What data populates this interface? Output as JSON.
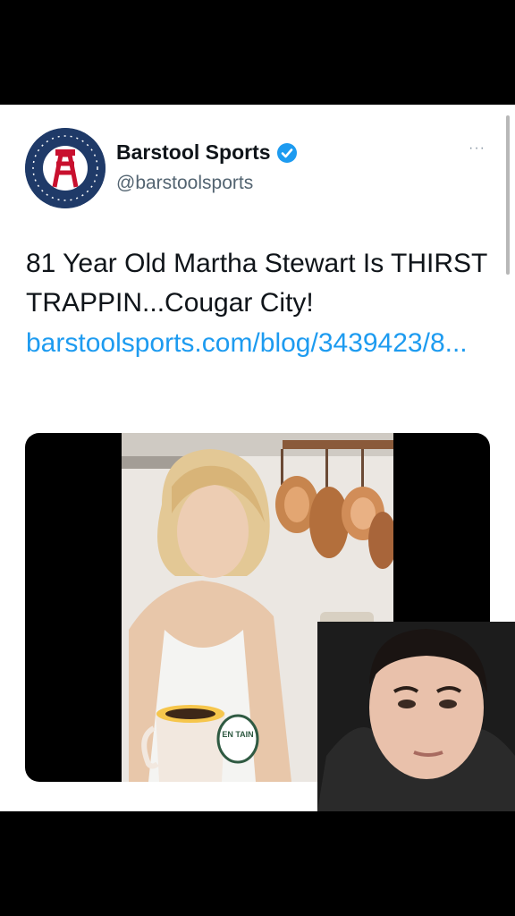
{
  "tweet": {
    "author_name": "Barstool Sports",
    "handle": "@barstoolsports",
    "text": "81 Year Old Martha Stewart Is THIRST TRAPPIN...Cougar City!",
    "link": "barstoolsports.com/blog/3439423/8...",
    "more_label": "···"
  },
  "media": {
    "mug_text": "EN TAIN"
  },
  "colors": {
    "link": "#1d9bf0",
    "verified": "#1d9bf0",
    "avatar_bg": "#1f3a68",
    "logo_red": "#c8102e"
  }
}
